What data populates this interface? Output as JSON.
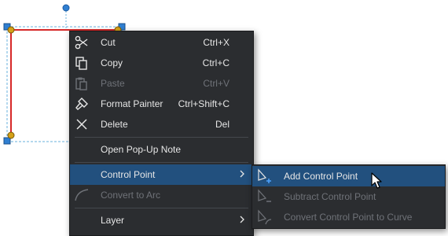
{
  "main_menu": {
    "items": [
      {
        "icon": "scissors-icon",
        "label": "Cut",
        "shortcut": "Ctrl+X"
      },
      {
        "icon": "copy-icon",
        "label": "Copy",
        "shortcut": "Ctrl+C"
      },
      {
        "icon": "paste-icon",
        "label": "Paste",
        "shortcut": "Ctrl+V",
        "disabled": true
      },
      {
        "icon": "format-painter-icon",
        "label": "Format Painter",
        "shortcut": "Ctrl+Shift+C"
      },
      {
        "icon": "close-icon",
        "label": "Delete",
        "shortcut": "Del"
      },
      {
        "label": "Open Pop-Up Note"
      },
      {
        "label": "Control Point",
        "submenu": true,
        "highlighted": true
      },
      {
        "icon": "arc-icon",
        "label": "Convert to Arc",
        "disabled": true
      },
      {
        "label": "Layer",
        "submenu": true
      }
    ]
  },
  "sub_menu": {
    "items": [
      {
        "icon": "add-control-point-icon",
        "label": "Add Control Point",
        "highlighted": true
      },
      {
        "icon": "subtract-control-point-icon",
        "label": "Subtract Control Point",
        "disabled": true
      },
      {
        "icon": "convert-control-point-icon",
        "label": "Convert Control Point to Curve",
        "disabled": true
      }
    ]
  },
  "colors": {
    "menu_bg": "#2b2d30",
    "highlight": "#22507e",
    "text": "#e6e6e6",
    "disabled_text": "#6f7278",
    "shape_stroke": "#d62828",
    "handle_blue": "#2f7fd1",
    "handle_yellow": "#d4a017"
  }
}
